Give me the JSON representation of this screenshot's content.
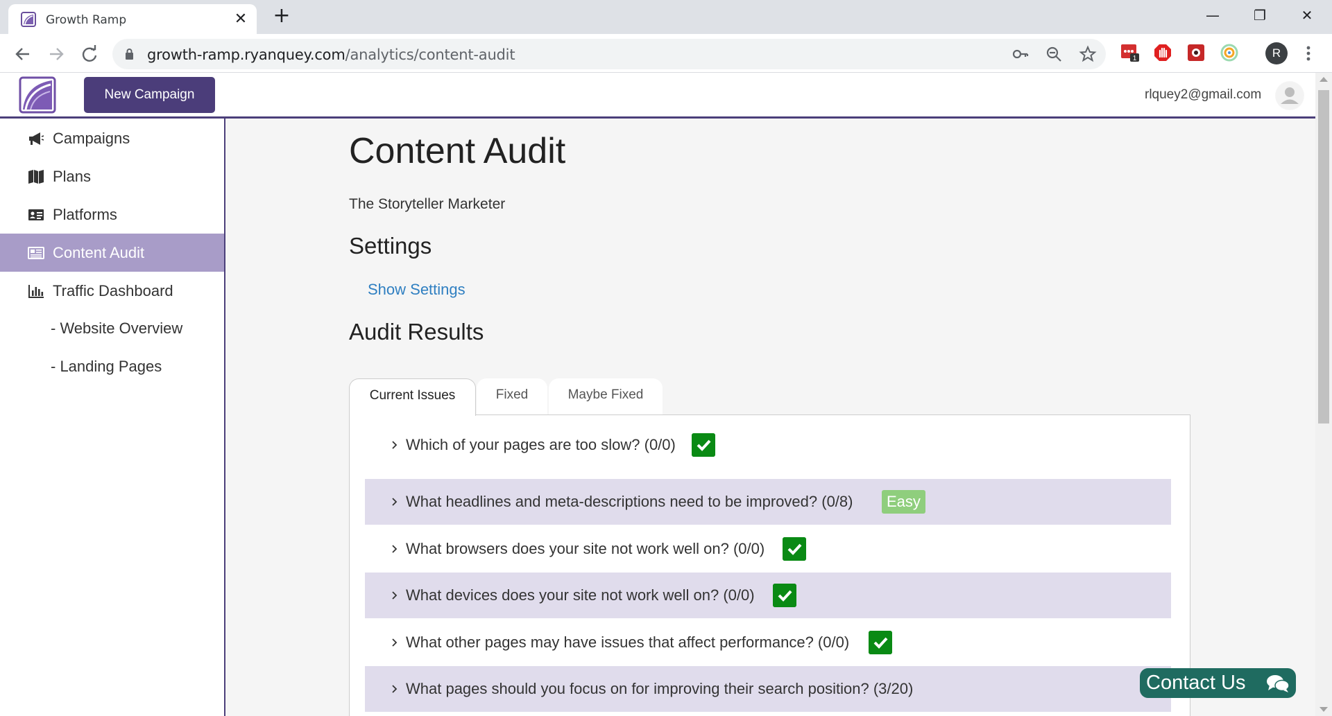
{
  "browser": {
    "tab_title": "Growth Ramp",
    "tab_close": "✕",
    "new_tab": "+",
    "url_host": "growth-ramp.ryanquey.com",
    "url_path": "/analytics/content-audit",
    "profile_initial": "R",
    "extension_badge": "1",
    "window_controls": {
      "minimize": "—",
      "restore": "❐",
      "close": "✕"
    }
  },
  "header": {
    "new_campaign_label": "New Campaign",
    "user_email": "rlquey2@gmail.com"
  },
  "sidebar": {
    "items": [
      {
        "label": "Campaigns",
        "icon": "megaphone-icon",
        "active": false
      },
      {
        "label": "Plans",
        "icon": "map-icon",
        "active": false
      },
      {
        "label": "Platforms",
        "icon": "id-card-icon",
        "active": false
      },
      {
        "label": "Content Audit",
        "icon": "newspaper-icon",
        "active": true
      },
      {
        "label": "Traffic Dashboard",
        "icon": "bar-chart-icon",
        "active": false
      }
    ],
    "sub_items": [
      {
        "label": "- Website Overview"
      },
      {
        "label": "- Landing Pages"
      }
    ]
  },
  "main": {
    "title": "Content Audit",
    "subtitle": "The Storyteller Marketer",
    "settings_heading": "Settings",
    "show_settings_link": "Show Settings",
    "results_heading": "Audit Results",
    "tabs": [
      {
        "label": "Current Issues",
        "active": true
      },
      {
        "label": "Fixed",
        "active": false
      },
      {
        "label": "Maybe Fixed",
        "active": false
      }
    ],
    "issues": [
      {
        "text": "Which of your pages are too slow? (0/0)",
        "badge": "check"
      },
      {
        "text": "What headlines and meta-descriptions need to be improved? (0/8)",
        "badge": "easy",
        "badge_label": "Easy"
      },
      {
        "text": "What browsers does your site not work well on? (0/0)",
        "badge": "check"
      },
      {
        "text": "What devices does your site not work well on? (0/0)",
        "badge": "check"
      },
      {
        "text": "What other pages may have issues that affect performance? (0/0)",
        "badge": "check"
      },
      {
        "text": "What pages should you focus on for improving their search position? (3/20)",
        "badge": "none"
      }
    ]
  },
  "contact": {
    "label": "Contact Us"
  },
  "colors": {
    "brand_purple": "#4b3d7a",
    "active_sidebar": "#a89cc8",
    "issue_row_alt": "#e0dcec",
    "check_green": "#0a8a14",
    "easy_green": "#8fce7d",
    "link_blue": "#2f7fc1",
    "contact_teal": "#1f6b60"
  }
}
